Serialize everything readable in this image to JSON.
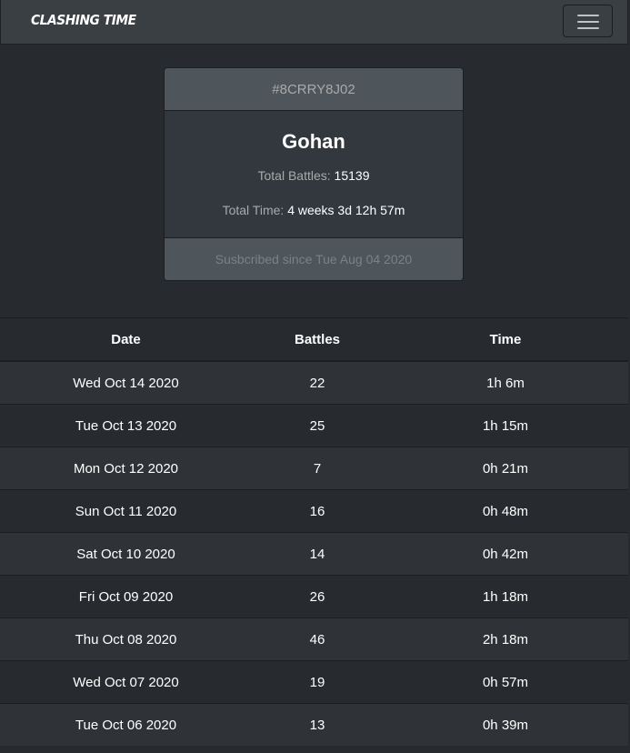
{
  "navbar": {
    "brand": "CLASHING TIME",
    "menu_icon": "hamburger-menu-icon"
  },
  "profile": {
    "tag": "#8CRRY8J02",
    "name": "Gohan",
    "battles_label": "Total Battles:",
    "battles_value": "15139",
    "time_label": "Total Time:",
    "time_value": "4 weeks 3d 12h 57m",
    "subscribed": "Susbcribed since Tue Aug 04 2020"
  },
  "table": {
    "headers": [
      "Date",
      "Battles",
      "Time"
    ],
    "rows": [
      [
        "Wed Oct 14 2020",
        "22",
        "1h 6m"
      ],
      [
        "Tue Oct 13 2020",
        "25",
        "1h 15m"
      ],
      [
        "Mon Oct 12 2020",
        "7",
        "0h 21m"
      ],
      [
        "Sun Oct 11 2020",
        "16",
        "0h 48m"
      ],
      [
        "Sat Oct 10 2020",
        "14",
        "0h 42m"
      ],
      [
        "Fri Oct 09 2020",
        "26",
        "1h 18m"
      ],
      [
        "Thu Oct 08 2020",
        "46",
        "2h 18m"
      ],
      [
        "Wed Oct 07 2020",
        "19",
        "0h 57m"
      ],
      [
        "Tue Oct 06 2020",
        "13",
        "0h 39m"
      ]
    ]
  },
  "colors": {
    "background": "#272b30",
    "navbar": "#3a3f44",
    "card_header": "#4e555b",
    "card_body": "#32383e",
    "striped_row": "#2f3337"
  }
}
